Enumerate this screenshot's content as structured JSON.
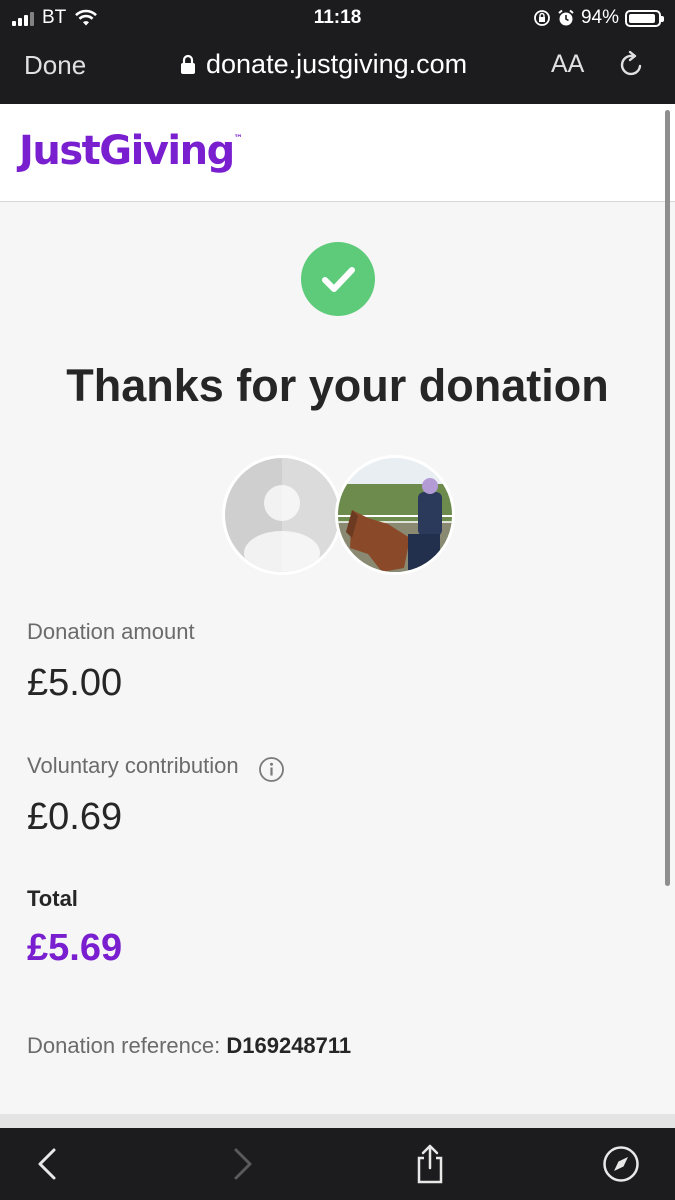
{
  "status_bar": {
    "carrier": "BT",
    "time": "11:18",
    "battery": "94%",
    "battery_level": 0.94
  },
  "browser": {
    "done_label": "Done",
    "url": "donate.justgiving.com",
    "aa_label": "AA"
  },
  "site": {
    "logo_text": "JustGiving",
    "logo_tm": "™",
    "brand_color": "#7a1fd0",
    "success_color": "#5ecb7a"
  },
  "confirmation": {
    "heading": "Thanks for your donation",
    "donation_amount_label": "Donation amount",
    "donation_amount": "£5.00",
    "voluntary_label": "Voluntary contribution",
    "voluntary_amount": "£0.69",
    "total_label": "Total",
    "total_amount": "£5.69",
    "reference_label": "Donation reference:",
    "reference_value": "D169248711"
  },
  "icons": {
    "check": "check-circle-icon",
    "info": "info-icon",
    "back": "chevron-left-icon",
    "forward": "chevron-right-icon",
    "share": "share-icon",
    "compass": "compass-icon"
  }
}
